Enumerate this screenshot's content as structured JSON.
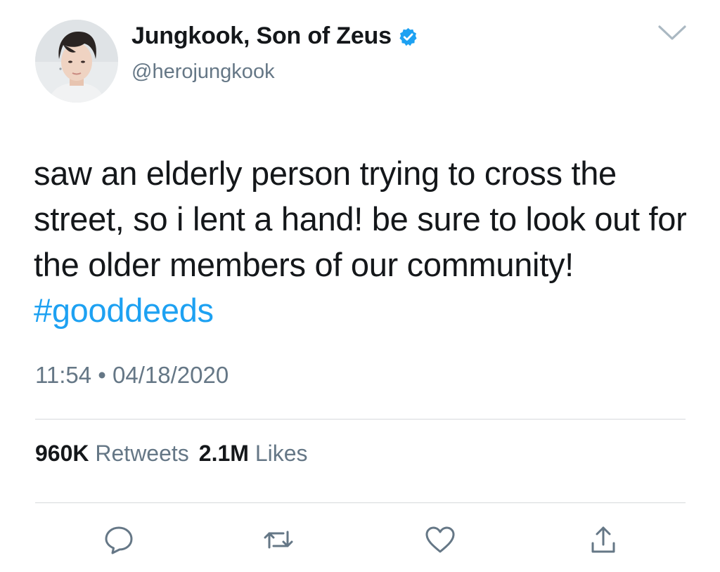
{
  "tweet": {
    "author": {
      "display_name": "Jungkook, Son of Zeus",
      "handle": "@herojungkook",
      "verified": true
    },
    "text_main": "saw an elderly person trying to cross the street, so i lent a hand! be sure to look out for the older members of our community! ",
    "hashtag": "#gooddeeds",
    "timestamp": "11:54 • 04/18/2020",
    "stats": {
      "retweets_count": "960K",
      "retweets_label": "Retweets",
      "likes_count": "2.1M",
      "likes_label": "Likes"
    },
    "actions": [
      {
        "name": "reply",
        "icon": "reply-bubble-icon"
      },
      {
        "name": "retweet",
        "icon": "retweet-icon"
      },
      {
        "name": "like",
        "icon": "heart-icon"
      },
      {
        "name": "share",
        "icon": "share-icon"
      }
    ]
  },
  "colors": {
    "text": "#14171a",
    "secondary": "#657786",
    "accent": "#1da1f2",
    "divider": "#d6d9dc"
  }
}
